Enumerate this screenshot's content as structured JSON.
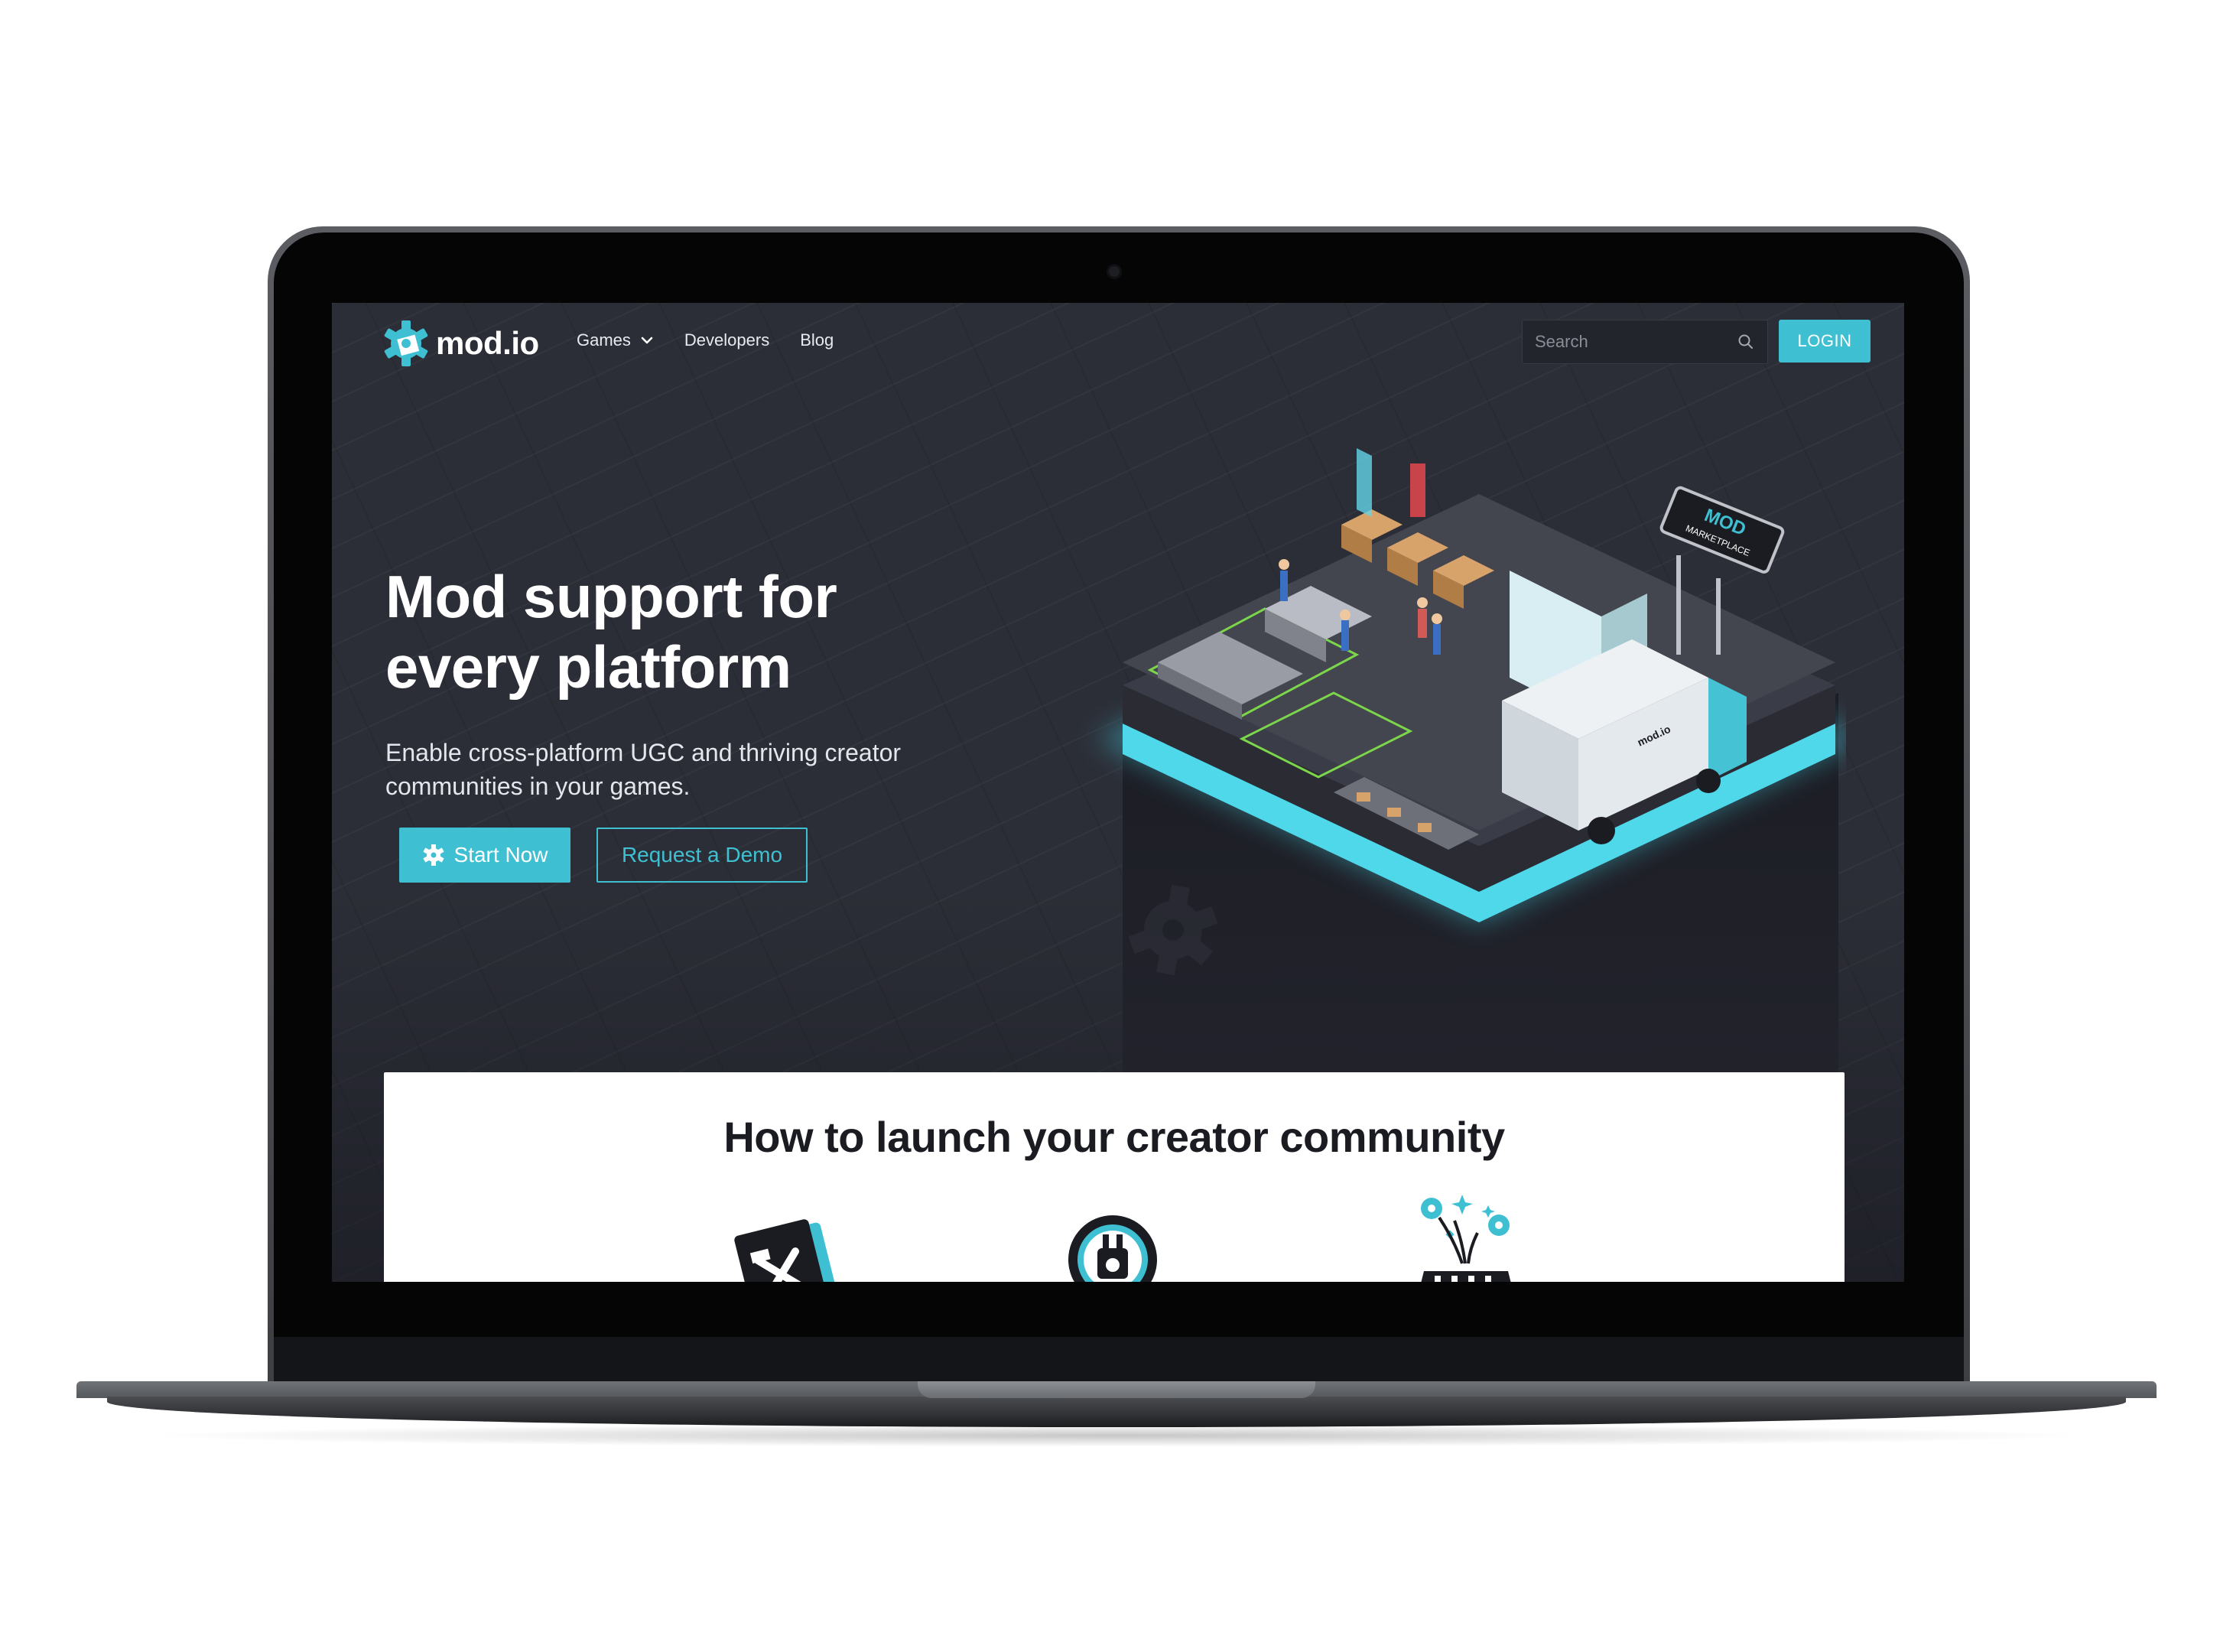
{
  "nav": {
    "logo_text": "mod.io",
    "links": [
      {
        "label": "Games",
        "has_dropdown": true
      },
      {
        "label": "Developers"
      },
      {
        "label": "Blog"
      }
    ],
    "search_placeholder": "Search",
    "login_label": "LOGIN"
  },
  "hero": {
    "title_line1": "Mod support for",
    "title_line2": "every platform",
    "subtitle_line1": "Enable cross-platform UGC and thriving creator",
    "subtitle_line2": "communities in your games.",
    "primary_cta": "Start Now",
    "secondary_cta": "Request a Demo",
    "illustration_text": {
      "sign_line1": "MOD",
      "sign_line2": "MARKETPLACE",
      "truck_logo": "mod.io"
    }
  },
  "section": {
    "title": "How to launch your creator community",
    "icons": [
      "tools-icon",
      "plug-icon",
      "launch-icon"
    ]
  },
  "colors": {
    "accent": "#3fc0d2",
    "background": "#2c2e37",
    "card": "#ffffff",
    "text_dark": "#1b1c22"
  }
}
